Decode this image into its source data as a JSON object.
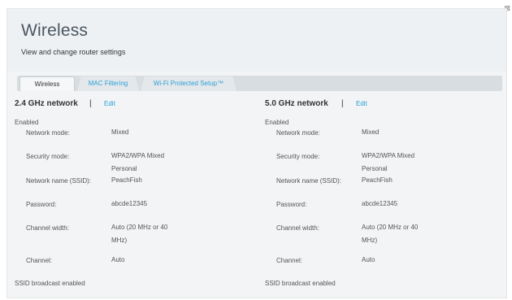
{
  "window": {
    "close_glyph": "⊠"
  },
  "header": {
    "title": "Wireless",
    "subtitle": "View and change router settings"
  },
  "tabs": [
    {
      "label": "Wireless",
      "active": true
    },
    {
      "label": "MAC Filtering",
      "active": false
    },
    {
      "label": "Wi-Fi Protected Setup™",
      "active": false
    }
  ],
  "colors": {
    "link": "#2a9fd6",
    "panel_bg": "#f2f4f5",
    "tabbar_bg": "#d8dde1"
  },
  "networks": [
    {
      "title": "2.4 GHz network",
      "separator": "|",
      "edit_label": "Edit",
      "status": "Enabled",
      "fields": {
        "mode_label": "Network mode:",
        "mode_value": "Mixed",
        "security_label": "Security mode:",
        "security_value": "WPA2/WPA Mixed Personal",
        "ssid_label": "Network name (SSID):",
        "ssid_value": "PeachFish",
        "password_label": "Password:",
        "password_value": "abcde12345",
        "width_label": "Channel width:",
        "width_value": "Auto (20 MHz or 40 MHz)",
        "channel_label": "Channel:",
        "channel_value": "Auto"
      },
      "broadcast": "SSID broadcast enabled"
    },
    {
      "title": "5.0 GHz network",
      "separator": "|",
      "edit_label": "Edit",
      "status": "Enabled",
      "fields": {
        "mode_label": "Network mode:",
        "mode_value": "Mixed",
        "security_label": "Security mode:",
        "security_value": "WPA2/WPA Mixed Personal",
        "ssid_label": "Network name (SSID):",
        "ssid_value": "PeachFish",
        "password_label": "Password:",
        "password_value": "abcde12345",
        "width_label": "Channel width:",
        "width_value": "Auto (20 MHz or 40 MHz)",
        "channel_label": "Channel:",
        "channel_value": "Auto"
      },
      "broadcast": "SSID broadcast enabled"
    }
  ]
}
